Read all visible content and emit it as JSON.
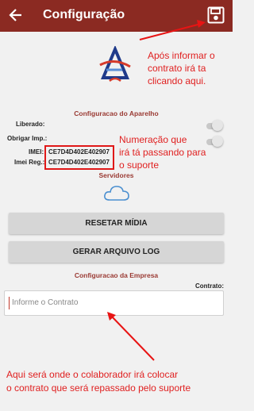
{
  "appbar": {
    "title": "Configuração"
  },
  "sections": {
    "device": "Configuracao do Aparelho",
    "servers": "Servidores",
    "company": "Configuracao da Empresa"
  },
  "device": {
    "liberado_label": "Liberado:",
    "obrigar_label": "Obrigar Imp.:",
    "imei_label": "IMEI:",
    "imei_value": "CE7D4D402E402907",
    "imei_reg_label": "Imei Reg.:",
    "imei_reg_value": "CE7D4D402E402907"
  },
  "buttons": {
    "reset_media": "RESETAR MÍDIA",
    "generate_log": "GERAR ARQUIVO LOG"
  },
  "contract": {
    "label": "Contrato:",
    "placeholder": "Informe o Contrato"
  },
  "annotations": {
    "save_note": [
      "Após informar o",
      "contrato irá ta",
      "clicando aqui."
    ],
    "imei_note": [
      "Numeração que",
      "irá tá passando para",
      "o suporte"
    ],
    "contract_note": [
      "Aqui será onde o colaborador irá colocar",
      "o contrato que será repassado pelo suporte"
    ]
  },
  "colors": {
    "appbar": "#8b2a22",
    "annotation": "#e02020",
    "section_title": "#9a3a33"
  }
}
